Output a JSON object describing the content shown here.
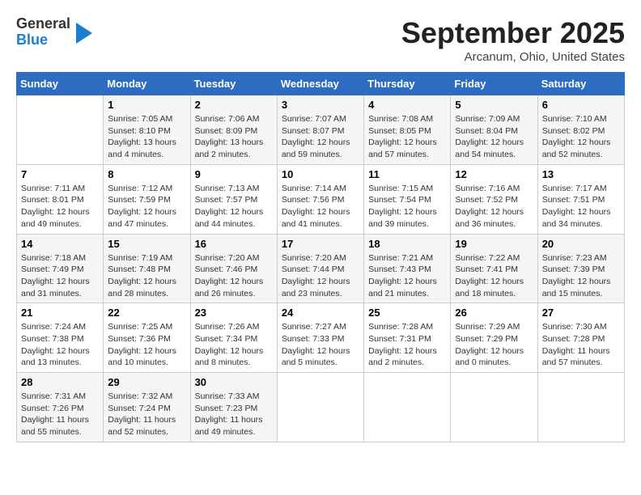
{
  "header": {
    "logo_general": "General",
    "logo_blue": "Blue",
    "title": "September 2025",
    "location": "Arcanum, Ohio, United States"
  },
  "weekdays": [
    "Sunday",
    "Monday",
    "Tuesday",
    "Wednesday",
    "Thursday",
    "Friday",
    "Saturday"
  ],
  "weeks": [
    [
      {
        "day": "",
        "info": ""
      },
      {
        "day": "1",
        "info": "Sunrise: 7:05 AM\nSunset: 8:10 PM\nDaylight: 13 hours\nand 4 minutes."
      },
      {
        "day": "2",
        "info": "Sunrise: 7:06 AM\nSunset: 8:09 PM\nDaylight: 13 hours\nand 2 minutes."
      },
      {
        "day": "3",
        "info": "Sunrise: 7:07 AM\nSunset: 8:07 PM\nDaylight: 12 hours\nand 59 minutes."
      },
      {
        "day": "4",
        "info": "Sunrise: 7:08 AM\nSunset: 8:05 PM\nDaylight: 12 hours\nand 57 minutes."
      },
      {
        "day": "5",
        "info": "Sunrise: 7:09 AM\nSunset: 8:04 PM\nDaylight: 12 hours\nand 54 minutes."
      },
      {
        "day": "6",
        "info": "Sunrise: 7:10 AM\nSunset: 8:02 PM\nDaylight: 12 hours\nand 52 minutes."
      }
    ],
    [
      {
        "day": "7",
        "info": "Sunrise: 7:11 AM\nSunset: 8:01 PM\nDaylight: 12 hours\nand 49 minutes."
      },
      {
        "day": "8",
        "info": "Sunrise: 7:12 AM\nSunset: 7:59 PM\nDaylight: 12 hours\nand 47 minutes."
      },
      {
        "day": "9",
        "info": "Sunrise: 7:13 AM\nSunset: 7:57 PM\nDaylight: 12 hours\nand 44 minutes."
      },
      {
        "day": "10",
        "info": "Sunrise: 7:14 AM\nSunset: 7:56 PM\nDaylight: 12 hours\nand 41 minutes."
      },
      {
        "day": "11",
        "info": "Sunrise: 7:15 AM\nSunset: 7:54 PM\nDaylight: 12 hours\nand 39 minutes."
      },
      {
        "day": "12",
        "info": "Sunrise: 7:16 AM\nSunset: 7:52 PM\nDaylight: 12 hours\nand 36 minutes."
      },
      {
        "day": "13",
        "info": "Sunrise: 7:17 AM\nSunset: 7:51 PM\nDaylight: 12 hours\nand 34 minutes."
      }
    ],
    [
      {
        "day": "14",
        "info": "Sunrise: 7:18 AM\nSunset: 7:49 PM\nDaylight: 12 hours\nand 31 minutes."
      },
      {
        "day": "15",
        "info": "Sunrise: 7:19 AM\nSunset: 7:48 PM\nDaylight: 12 hours\nand 28 minutes."
      },
      {
        "day": "16",
        "info": "Sunrise: 7:20 AM\nSunset: 7:46 PM\nDaylight: 12 hours\nand 26 minutes."
      },
      {
        "day": "17",
        "info": "Sunrise: 7:20 AM\nSunset: 7:44 PM\nDaylight: 12 hours\nand 23 minutes."
      },
      {
        "day": "18",
        "info": "Sunrise: 7:21 AM\nSunset: 7:43 PM\nDaylight: 12 hours\nand 21 minutes."
      },
      {
        "day": "19",
        "info": "Sunrise: 7:22 AM\nSunset: 7:41 PM\nDaylight: 12 hours\nand 18 minutes."
      },
      {
        "day": "20",
        "info": "Sunrise: 7:23 AM\nSunset: 7:39 PM\nDaylight: 12 hours\nand 15 minutes."
      }
    ],
    [
      {
        "day": "21",
        "info": "Sunrise: 7:24 AM\nSunset: 7:38 PM\nDaylight: 12 hours\nand 13 minutes."
      },
      {
        "day": "22",
        "info": "Sunrise: 7:25 AM\nSunset: 7:36 PM\nDaylight: 12 hours\nand 10 minutes."
      },
      {
        "day": "23",
        "info": "Sunrise: 7:26 AM\nSunset: 7:34 PM\nDaylight: 12 hours\nand 8 minutes."
      },
      {
        "day": "24",
        "info": "Sunrise: 7:27 AM\nSunset: 7:33 PM\nDaylight: 12 hours\nand 5 minutes."
      },
      {
        "day": "25",
        "info": "Sunrise: 7:28 AM\nSunset: 7:31 PM\nDaylight: 12 hours\nand 2 minutes."
      },
      {
        "day": "26",
        "info": "Sunrise: 7:29 AM\nSunset: 7:29 PM\nDaylight: 12 hours\nand 0 minutes."
      },
      {
        "day": "27",
        "info": "Sunrise: 7:30 AM\nSunset: 7:28 PM\nDaylight: 11 hours\nand 57 minutes."
      }
    ],
    [
      {
        "day": "28",
        "info": "Sunrise: 7:31 AM\nSunset: 7:26 PM\nDaylight: 11 hours\nand 55 minutes."
      },
      {
        "day": "29",
        "info": "Sunrise: 7:32 AM\nSunset: 7:24 PM\nDaylight: 11 hours\nand 52 minutes."
      },
      {
        "day": "30",
        "info": "Sunrise: 7:33 AM\nSunset: 7:23 PM\nDaylight: 11 hours\nand 49 minutes."
      },
      {
        "day": "",
        "info": ""
      },
      {
        "day": "",
        "info": ""
      },
      {
        "day": "",
        "info": ""
      },
      {
        "day": "",
        "info": ""
      }
    ]
  ]
}
